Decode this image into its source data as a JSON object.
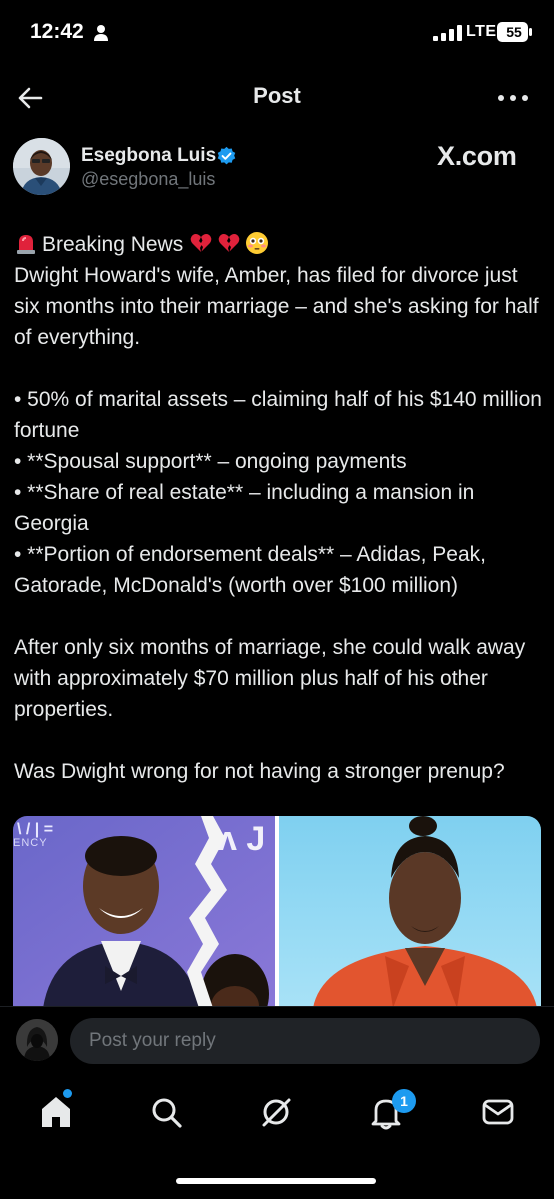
{
  "status_bar": {
    "time": "12:42",
    "network": "LTE",
    "battery": "55"
  },
  "header": {
    "title": "Post"
  },
  "author": {
    "name": "Esegbona Luis",
    "handle": "@esegbona_luis",
    "verified": true,
    "source_label": "X.com"
  },
  "tweet": {
    "headline": "Breaking News",
    "headline_emojis": [
      "broken-heart",
      "broken-heart",
      "flushed-face"
    ],
    "intro": "Dwight Howard's wife, Amber, has filed for divorce just six months into their marriage – and she's asking for half of everything.",
    "bullets": [
      "• 50% of marital assets – claiming half of his $140 million fortune",
      "• **Spousal support** – ongoing payments",
      "• **Share of real estate** – including a mansion in Georgia",
      "• **Portion of endorsement deals** – Adidas, Peak, Gatorade, McDonald's (worth over $100 million)"
    ],
    "paragraph": "After only six months of marriage, she could walk away with approximately $70 million plus half of his other properties.",
    "question": "Was Dwight wrong for not having a stronger prenup?"
  },
  "media": {
    "left_backdrop_text": "ENCY"
  },
  "reply": {
    "placeholder": "Post your reply"
  },
  "bottom_nav": {
    "items": [
      "home",
      "search",
      "grok",
      "notifications",
      "messages"
    ],
    "notification_count": "1"
  },
  "colors": {
    "background": "#000000",
    "text": "#e7e9ea",
    "secondary_text": "#71767b",
    "accent": "#1d9bf0"
  }
}
